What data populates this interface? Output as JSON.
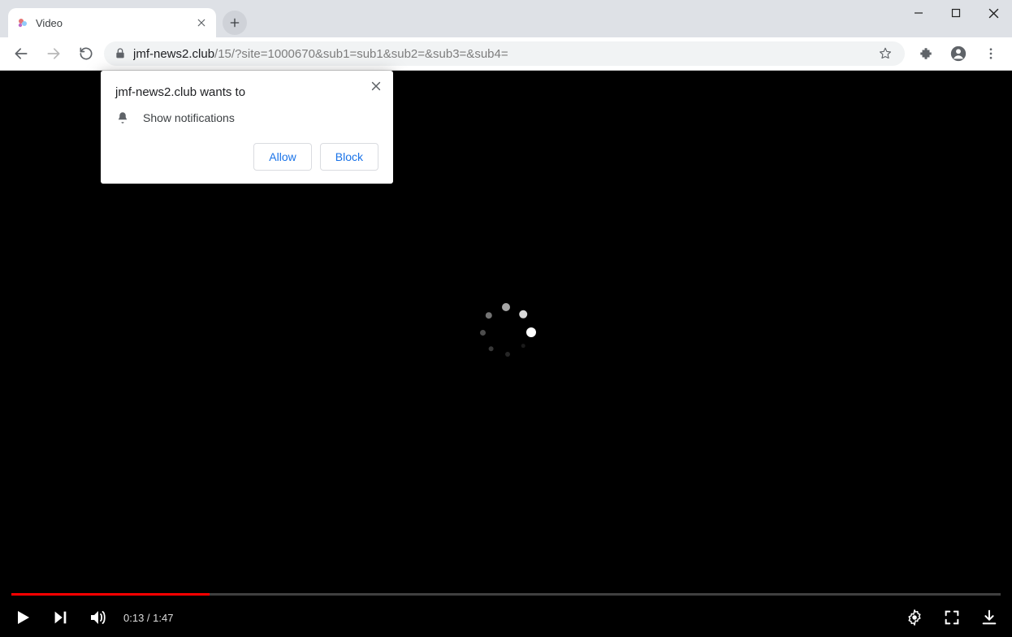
{
  "tab": {
    "title": "Video"
  },
  "url": {
    "host": "jmf-news2.club",
    "path": "/15/?site=1000670&sub1=sub1&sub2=&sub3=&sub4="
  },
  "permission_popup": {
    "title": "jmf-news2.club wants to",
    "line": "Show notifications",
    "allow": "Allow",
    "block": "Block"
  },
  "player": {
    "current": "0:13",
    "sep": " / ",
    "duration": "1:47",
    "progress_percent": 20
  }
}
